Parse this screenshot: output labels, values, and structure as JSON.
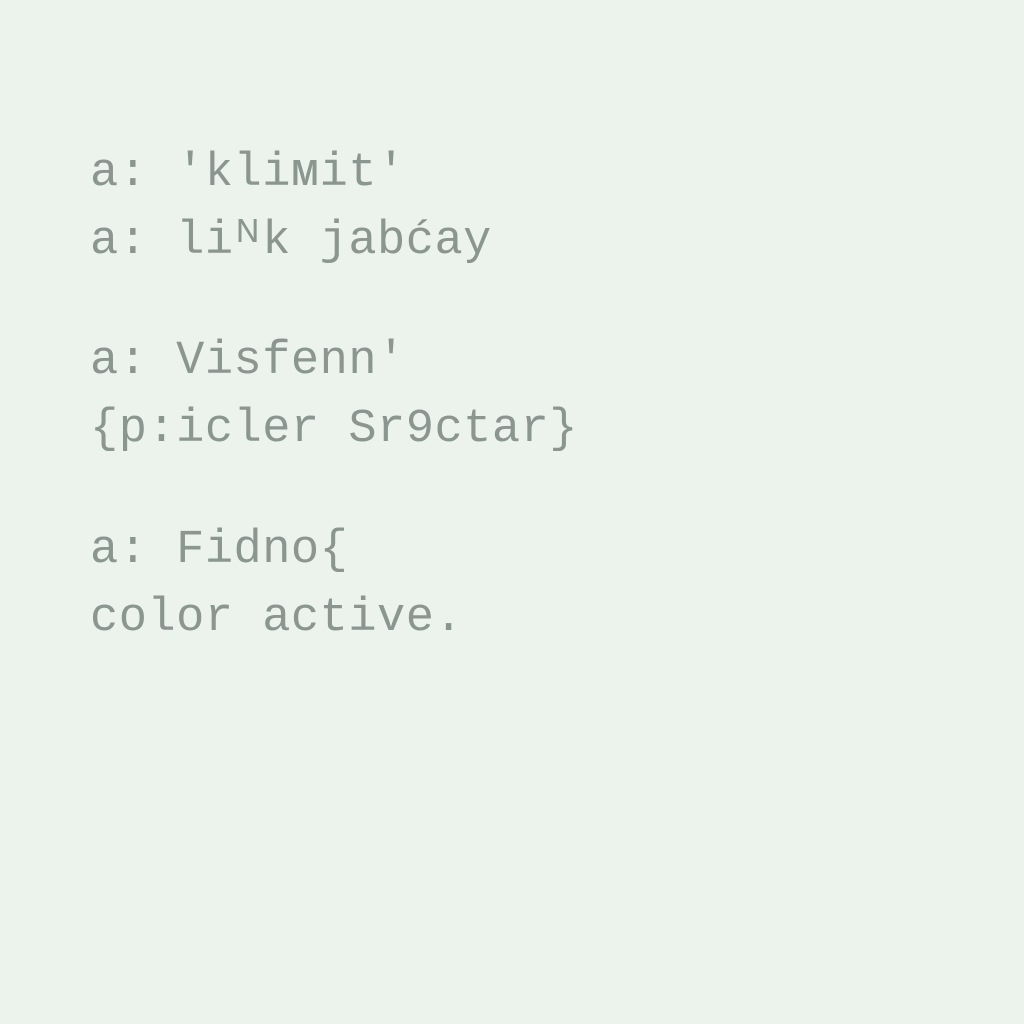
{
  "blocks": [
    {
      "line1": "a: 'kliᴍit'",
      "line2": "a: liᴺk jabćay"
    },
    {
      "line1": "a: Visfenn'",
      "line2": "{p:icler Sr9ctar}"
    },
    {
      "line1": "a: Fidno{",
      "line2": "color active."
    }
  ]
}
